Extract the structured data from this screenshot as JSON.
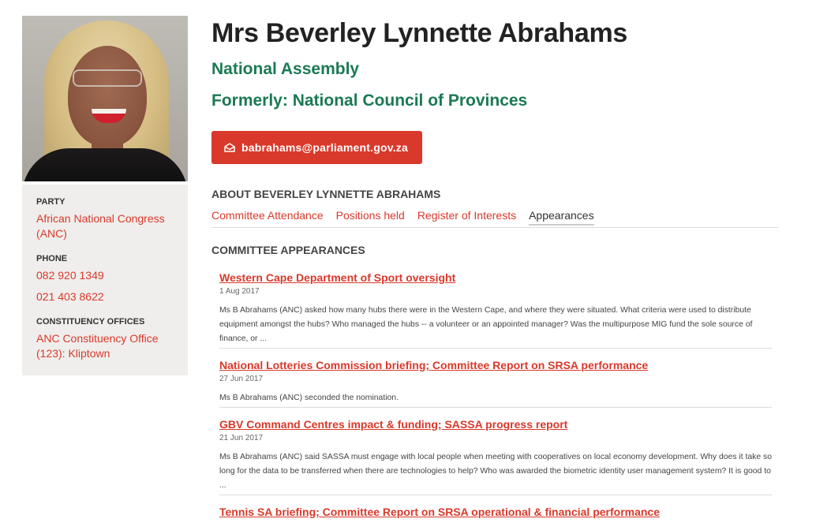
{
  "profile": {
    "name": "Mrs Beverley Lynnette Abrahams",
    "house": "National Assembly",
    "former": "Formerly: National Council of Provinces",
    "email": "babrahams@parliament.gov.za",
    "photo_alt": "Beverley Lynnette Abrahams"
  },
  "sidebar": {
    "party_label": "PARTY",
    "party": "African National Congress (ANC)",
    "phone_label": "PHONE",
    "phone1": "082 920 1349",
    "phone2": "021 403 8622",
    "offices_label": "CONSTITUENCY OFFICES",
    "office": "ANC Constituency Office (123): Kliptown"
  },
  "about": {
    "heading": "ABOUT BEVERLEY LYNNETTE ABRAHAMS",
    "tabs": [
      "Committee Attendance",
      "Positions held",
      "Register of Interests",
      "Appearances"
    ],
    "active_tab": "Appearances"
  },
  "appearances": {
    "heading": "COMMITTEE APPEARANCES",
    "items": [
      {
        "title": "Western Cape Department of Sport oversight",
        "date": "1 Aug 2017",
        "text": "Ms B Abrahams (ANC) asked how many hubs there were in the Western Cape, and where they were situated. What criteria were used to distribute equipment amongst the hubs? Who managed the hubs -- a volunteer or an appointed manager? Was the multipurpose MIG fund the sole source of finance, or ..."
      },
      {
        "title": "National Lotteries Commission briefing; Committee Report on SRSA performance",
        "date": "27 Jun 2017",
        "text": "Ms B Abrahams (ANC) seconded the nomination."
      },
      {
        "title": "GBV Command Centres impact & funding; SASSA progress report",
        "date": "21 Jun 2017",
        "text": "Ms B Abrahams (ANC) said SASSA must engage with local people when meeting with cooperatives on local economy development. Why does it take so long for the data to be transferred when there are technologies to help? Who was awarded the biometric identity user management system? It is good to ..."
      },
      {
        "title": "Tennis SA briefing; Committee Report on SRSA operational & financial performance",
        "date": "",
        "text": ""
      }
    ]
  },
  "colors": {
    "accent": "#d9392b",
    "green": "#1a7a53",
    "sidebar_bg": "#efeeec"
  }
}
